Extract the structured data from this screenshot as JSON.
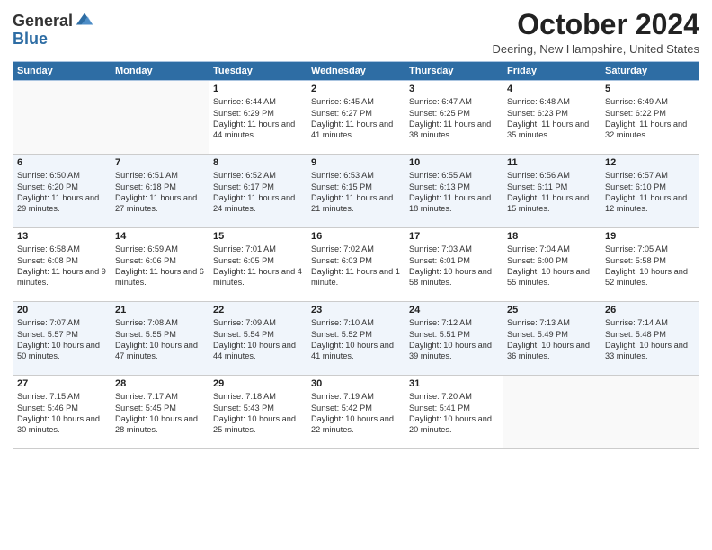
{
  "header": {
    "logo_general": "General",
    "logo_blue": "Blue",
    "month_title": "October 2024",
    "location": "Deering, New Hampshire, United States"
  },
  "days_of_week": [
    "Sunday",
    "Monday",
    "Tuesday",
    "Wednesday",
    "Thursday",
    "Friday",
    "Saturday"
  ],
  "weeks": [
    [
      {
        "day": "",
        "detail": ""
      },
      {
        "day": "",
        "detail": ""
      },
      {
        "day": "1",
        "detail": "Sunrise: 6:44 AM\nSunset: 6:29 PM\nDaylight: 11 hours and 44 minutes."
      },
      {
        "day": "2",
        "detail": "Sunrise: 6:45 AM\nSunset: 6:27 PM\nDaylight: 11 hours and 41 minutes."
      },
      {
        "day": "3",
        "detail": "Sunrise: 6:47 AM\nSunset: 6:25 PM\nDaylight: 11 hours and 38 minutes."
      },
      {
        "day": "4",
        "detail": "Sunrise: 6:48 AM\nSunset: 6:23 PM\nDaylight: 11 hours and 35 minutes."
      },
      {
        "day": "5",
        "detail": "Sunrise: 6:49 AM\nSunset: 6:22 PM\nDaylight: 11 hours and 32 minutes."
      }
    ],
    [
      {
        "day": "6",
        "detail": "Sunrise: 6:50 AM\nSunset: 6:20 PM\nDaylight: 11 hours and 29 minutes."
      },
      {
        "day": "7",
        "detail": "Sunrise: 6:51 AM\nSunset: 6:18 PM\nDaylight: 11 hours and 27 minutes."
      },
      {
        "day": "8",
        "detail": "Sunrise: 6:52 AM\nSunset: 6:17 PM\nDaylight: 11 hours and 24 minutes."
      },
      {
        "day": "9",
        "detail": "Sunrise: 6:53 AM\nSunset: 6:15 PM\nDaylight: 11 hours and 21 minutes."
      },
      {
        "day": "10",
        "detail": "Sunrise: 6:55 AM\nSunset: 6:13 PM\nDaylight: 11 hours and 18 minutes."
      },
      {
        "day": "11",
        "detail": "Sunrise: 6:56 AM\nSunset: 6:11 PM\nDaylight: 11 hours and 15 minutes."
      },
      {
        "day": "12",
        "detail": "Sunrise: 6:57 AM\nSunset: 6:10 PM\nDaylight: 11 hours and 12 minutes."
      }
    ],
    [
      {
        "day": "13",
        "detail": "Sunrise: 6:58 AM\nSunset: 6:08 PM\nDaylight: 11 hours and 9 minutes."
      },
      {
        "day": "14",
        "detail": "Sunrise: 6:59 AM\nSunset: 6:06 PM\nDaylight: 11 hours and 6 minutes."
      },
      {
        "day": "15",
        "detail": "Sunrise: 7:01 AM\nSunset: 6:05 PM\nDaylight: 11 hours and 4 minutes."
      },
      {
        "day": "16",
        "detail": "Sunrise: 7:02 AM\nSunset: 6:03 PM\nDaylight: 11 hours and 1 minute."
      },
      {
        "day": "17",
        "detail": "Sunrise: 7:03 AM\nSunset: 6:01 PM\nDaylight: 10 hours and 58 minutes."
      },
      {
        "day": "18",
        "detail": "Sunrise: 7:04 AM\nSunset: 6:00 PM\nDaylight: 10 hours and 55 minutes."
      },
      {
        "day": "19",
        "detail": "Sunrise: 7:05 AM\nSunset: 5:58 PM\nDaylight: 10 hours and 52 minutes."
      }
    ],
    [
      {
        "day": "20",
        "detail": "Sunrise: 7:07 AM\nSunset: 5:57 PM\nDaylight: 10 hours and 50 minutes."
      },
      {
        "day": "21",
        "detail": "Sunrise: 7:08 AM\nSunset: 5:55 PM\nDaylight: 10 hours and 47 minutes."
      },
      {
        "day": "22",
        "detail": "Sunrise: 7:09 AM\nSunset: 5:54 PM\nDaylight: 10 hours and 44 minutes."
      },
      {
        "day": "23",
        "detail": "Sunrise: 7:10 AM\nSunset: 5:52 PM\nDaylight: 10 hours and 41 minutes."
      },
      {
        "day": "24",
        "detail": "Sunrise: 7:12 AM\nSunset: 5:51 PM\nDaylight: 10 hours and 39 minutes."
      },
      {
        "day": "25",
        "detail": "Sunrise: 7:13 AM\nSunset: 5:49 PM\nDaylight: 10 hours and 36 minutes."
      },
      {
        "day": "26",
        "detail": "Sunrise: 7:14 AM\nSunset: 5:48 PM\nDaylight: 10 hours and 33 minutes."
      }
    ],
    [
      {
        "day": "27",
        "detail": "Sunrise: 7:15 AM\nSunset: 5:46 PM\nDaylight: 10 hours and 30 minutes."
      },
      {
        "day": "28",
        "detail": "Sunrise: 7:17 AM\nSunset: 5:45 PM\nDaylight: 10 hours and 28 minutes."
      },
      {
        "day": "29",
        "detail": "Sunrise: 7:18 AM\nSunset: 5:43 PM\nDaylight: 10 hours and 25 minutes."
      },
      {
        "day": "30",
        "detail": "Sunrise: 7:19 AM\nSunset: 5:42 PM\nDaylight: 10 hours and 22 minutes."
      },
      {
        "day": "31",
        "detail": "Sunrise: 7:20 AM\nSunset: 5:41 PM\nDaylight: 10 hours and 20 minutes."
      },
      {
        "day": "",
        "detail": ""
      },
      {
        "day": "",
        "detail": ""
      }
    ]
  ]
}
